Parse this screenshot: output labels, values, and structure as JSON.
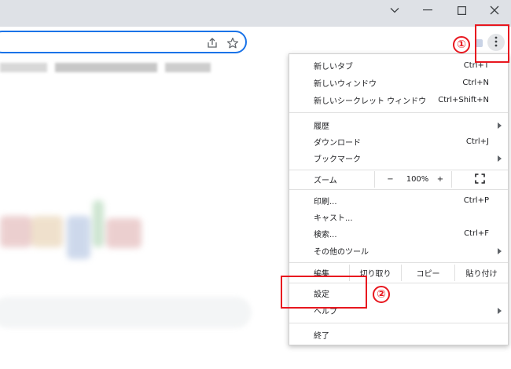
{
  "window": {
    "controls": {
      "tab_search_icon": "chevron-down-icon",
      "minimize_icon": "minimize-icon",
      "maximize_icon": "maximize-icon",
      "close_icon": "close-icon"
    }
  },
  "toolbar": {
    "share_icon": "share-icon",
    "bookmark_icon": "star-icon",
    "menu_icon": "three-dot-icon"
  },
  "menu": {
    "items": [
      {
        "label": "新しいタブ",
        "shortcut": "Ctrl+T"
      },
      {
        "label": "新しいウィンドウ",
        "shortcut": "Ctrl+N"
      },
      {
        "label": "新しいシークレット ウィンドウ",
        "shortcut": "Ctrl+Shift+N"
      },
      {
        "label": "履歴",
        "shortcut": ""
      },
      {
        "label": "ダウンロード",
        "shortcut": "Ctrl+J"
      },
      {
        "label": "ブックマーク",
        "shortcut": ""
      },
      {
        "label": "印刷...",
        "shortcut": "Ctrl+P"
      },
      {
        "label": "キャスト...",
        "shortcut": ""
      },
      {
        "label": "検索...",
        "shortcut": "Ctrl+F"
      },
      {
        "label": "その他のツール",
        "shortcut": ""
      },
      {
        "label": "設定",
        "shortcut": ""
      },
      {
        "label": "ヘルプ",
        "shortcut": ""
      },
      {
        "label": "終了",
        "shortcut": ""
      }
    ],
    "zoom": {
      "label": "ズーム",
      "minus": "−",
      "value": "100%",
      "plus": "+",
      "fullscreen_icon": "fullscreen-icon"
    },
    "edit": {
      "label": "編集",
      "cut": "切り取り",
      "copy": "コピー",
      "paste": "貼り付け"
    }
  },
  "annotations": {
    "step1": "①",
    "step2": "②"
  },
  "colors": {
    "accent": "#1a73e8",
    "highlight": "#e8171f",
    "titlebar": "#dee1e6"
  }
}
